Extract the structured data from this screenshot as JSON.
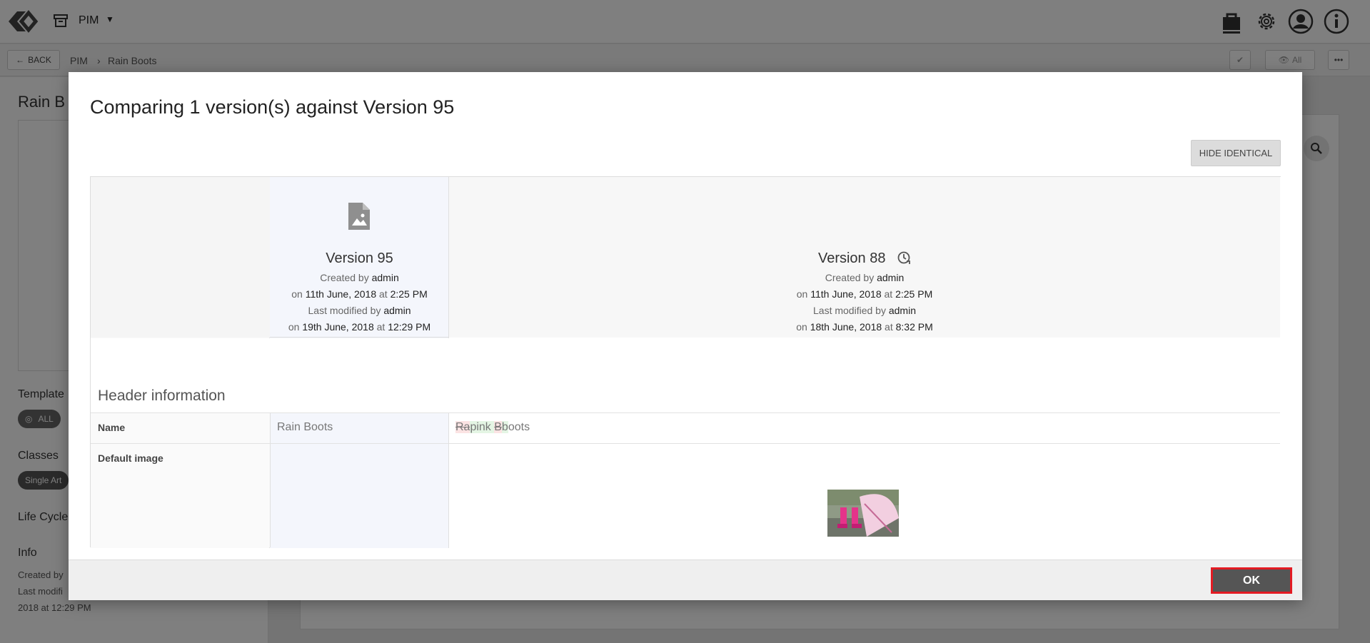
{
  "topbar": {
    "app_label": "PIM",
    "icons": [
      "logo-icon",
      "archive-icon",
      "shop-icon",
      "settings-icon",
      "user-icon",
      "info-icon"
    ]
  },
  "subbar": {
    "back_label": "BACK",
    "breadcrumb": [
      "PIM",
      "Rain Boots"
    ],
    "view_all_label": "All"
  },
  "left_panel": {
    "title": "Rain B",
    "template_label": "Template",
    "template_value": "ALL",
    "classes_label": "Classes",
    "class_pill": "Single Art",
    "lifecycle_label": "Life Cycle",
    "info_label": "Info",
    "info_lines": [
      "Created by",
      "Last modifi",
      "2018 at 12:29 PM"
    ]
  },
  "modal": {
    "title": "Comparing 1 version(s) against Version 95",
    "hide_identical_label": "HIDE IDENTICAL",
    "ok_label": "OK",
    "base_version": {
      "name": "Version 95",
      "created_by_prefix": "Created by",
      "created_by": "admin",
      "created_on_prefix": "on",
      "created_date": "11th June, 2018",
      "at": "at",
      "created_time": "2:25 PM",
      "modified_by_prefix": "Last modified by",
      "modified_by": "admin",
      "modified_date": "19th June, 2018",
      "modified_time": "12:29 PM"
    },
    "compare_version": {
      "name": "Version 88",
      "created_by_prefix": "Created by",
      "created_by": "admin",
      "created_on_prefix": "on",
      "created_date": "11th June, 2018",
      "at": "at",
      "created_time": "2:25 PM",
      "modified_by_prefix": "Last modified by",
      "modified_by": "admin",
      "modified_date": "18th June, 2018",
      "modified_time": "8:32 PM"
    },
    "section_title": "Header information",
    "rows": [
      {
        "label": "Name",
        "base_value": "Rain Boots",
        "diff": [
          {
            "type": "del",
            "text": "Ra"
          },
          {
            "type": "ins",
            "text": "pink "
          },
          {
            "type": "del",
            "text": "B"
          },
          {
            "type": "ins",
            "text": "b"
          },
          {
            "type": "same",
            "text": "oots"
          }
        ]
      },
      {
        "label": "Default image",
        "base_value": "",
        "compare_image": "pink-rain-boots-umbrella-thumbnail"
      }
    ]
  }
}
